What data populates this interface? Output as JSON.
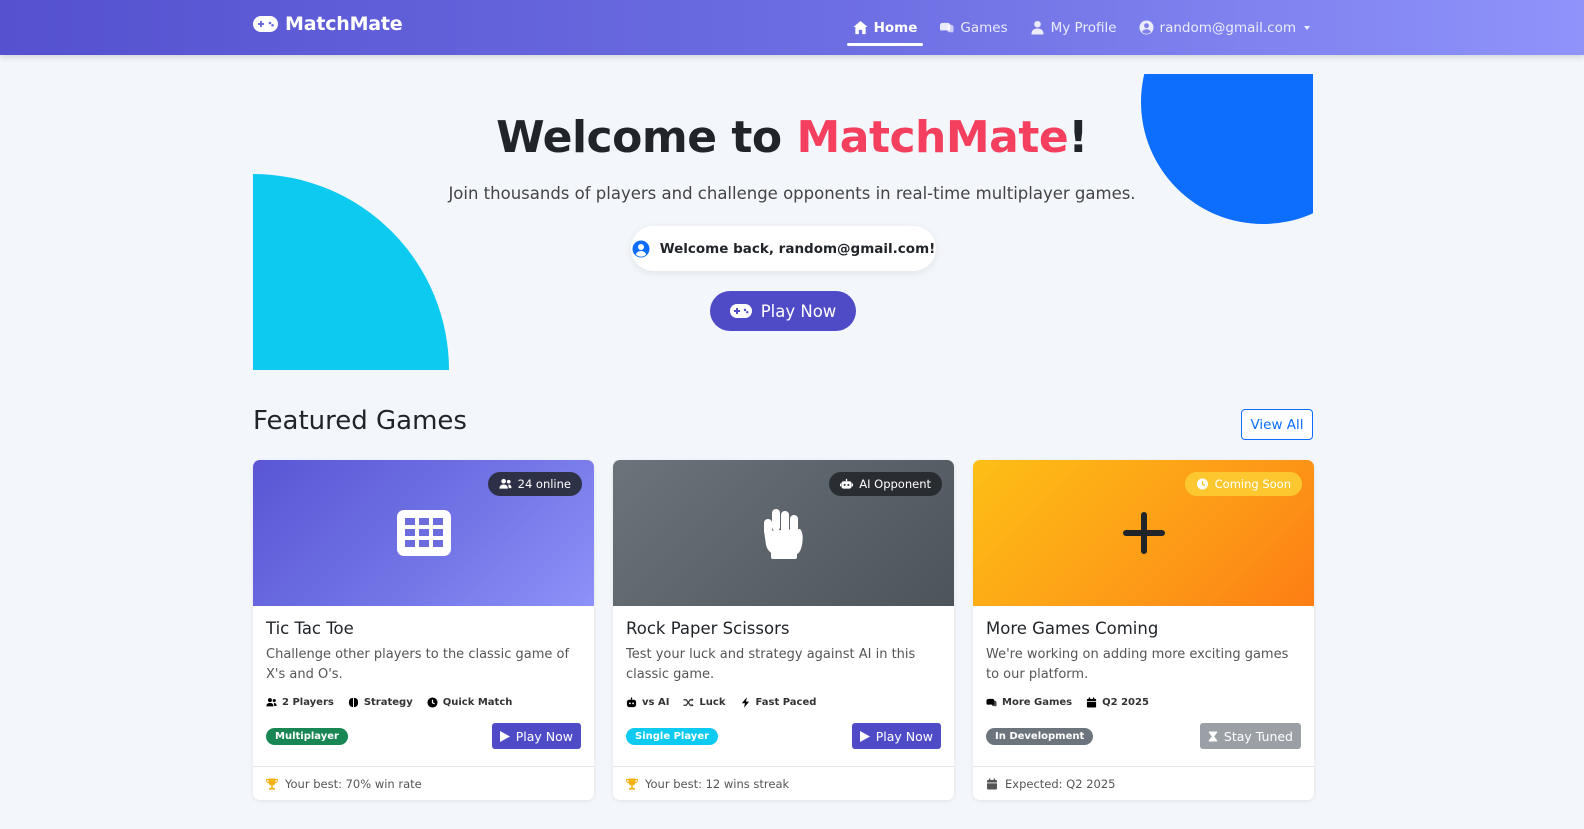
{
  "nav": {
    "brand": "MatchMate",
    "items": [
      {
        "label": "Home",
        "icon": "home-icon",
        "active": true
      },
      {
        "label": "Games",
        "icon": "gamepad-icon",
        "active": false
      },
      {
        "label": "My Profile",
        "icon": "user-icon",
        "active": false
      }
    ],
    "account": "random@gmail.com"
  },
  "hero": {
    "title_prefix": "Welcome to ",
    "title_accent": "MatchMate",
    "title_suffix": "!",
    "subtitle": "Join thousands of players and challenge opponents in real-time multiplayer games.",
    "welcome": "Welcome back, random@gmail.com!",
    "play_button": "Play Now"
  },
  "featured": {
    "title": "Featured Games",
    "view_all": "View All",
    "cards": [
      {
        "badge": "24 online",
        "title": "Tic Tac Toe",
        "description": "Challenge other players to the classic game of X's and O's.",
        "tags": [
          "2 Players",
          "Strategy",
          "Quick Match"
        ],
        "pill": "Multiplayer",
        "button": "Play Now",
        "footer": "Your best: 70% win rate"
      },
      {
        "badge": "AI Opponent",
        "title": "Rock Paper Scissors",
        "description": "Test your luck and strategy against AI in this classic game.",
        "tags": [
          "vs AI",
          "Luck",
          "Fast Paced"
        ],
        "pill": "Single Player",
        "button": "Play Now",
        "footer": "Your best: 12 wins streak"
      },
      {
        "badge": "Coming Soon",
        "title": "More Games Coming",
        "description": "We're working on adding more exciting games to our platform.",
        "tags": [
          "More Games",
          "Q2 2025"
        ],
        "pill": "In Development",
        "button": "Stay Tuned",
        "footer": "Expected: Q2 2025"
      }
    ]
  },
  "colors": {
    "primary": "#4f4bc7",
    "accent": "#f43f5e",
    "cyan": "#0dcaf0",
    "blue": "#0d6efd",
    "success": "#198754",
    "warning": "#fd7e14"
  }
}
